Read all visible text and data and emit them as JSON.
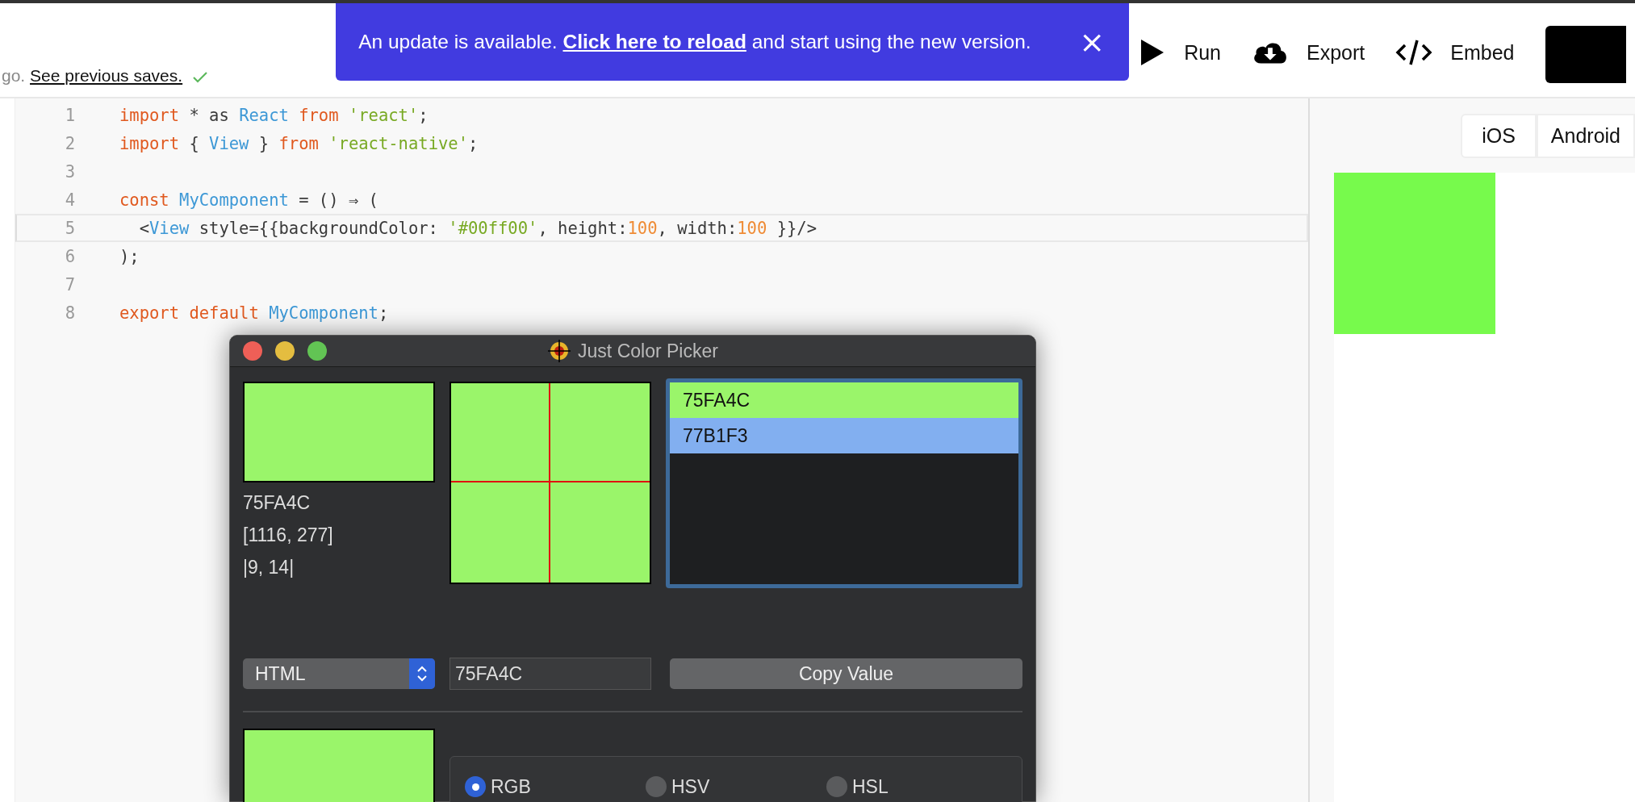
{
  "header": {
    "save_status": {
      "prefix": "go.",
      "link": "See previous saves."
    },
    "banner": {
      "before": "An update is available.",
      "link": "Click here to reload",
      "after": "and start using the new version.",
      "close": "×"
    },
    "actions": [
      {
        "label": "Run"
      },
      {
        "label": "Export"
      },
      {
        "label": "Embed"
      }
    ]
  },
  "editor": {
    "lines": [
      {
        "number": "1",
        "current": false,
        "tokens": [
          {
            "text": "import",
            "kind": "keyword"
          },
          {
            "text": " * as ",
            "kind": "plain"
          },
          {
            "text": "React",
            "kind": "ident"
          },
          {
            "text": " from ",
            "kind": "keyword"
          },
          {
            "text": "'react'",
            "kind": "string"
          },
          {
            "text": ";",
            "kind": "plain"
          }
        ]
      },
      {
        "number": "2",
        "current": false,
        "tokens": [
          {
            "text": "import",
            "kind": "keyword"
          },
          {
            "text": " { ",
            "kind": "plain"
          },
          {
            "text": "View",
            "kind": "ident"
          },
          {
            "text": " } ",
            "kind": "plain"
          },
          {
            "text": "from ",
            "kind": "keyword"
          },
          {
            "text": "'react-native'",
            "kind": "string"
          },
          {
            "text": ";",
            "kind": "plain"
          }
        ]
      },
      {
        "number": "3",
        "current": false
      },
      {
        "number": "4",
        "current": false,
        "tokens": [
          {
            "text": "const ",
            "kind": "keyword"
          },
          {
            "text": "MyComponent",
            "kind": "ident"
          },
          {
            "text": " = () ⇒ (",
            "kind": "plain"
          }
        ]
      },
      {
        "number": "5",
        "current": true,
        "tokens": [
          {
            "text": "  <",
            "kind": "plain"
          },
          {
            "text": "View",
            "kind": "ident"
          },
          {
            "text": " style={{backgroundColor: ",
            "kind": "plain"
          },
          {
            "text": "'#00ff00'",
            "kind": "string"
          },
          {
            "text": ", height:",
            "kind": "plain"
          },
          {
            "text": "100",
            "kind": "number"
          },
          {
            "text": ", width:",
            "kind": "plain"
          },
          {
            "text": "100",
            "kind": "number"
          },
          {
            "text": " }}/>",
            "kind": "plain"
          }
        ]
      },
      {
        "number": "6",
        "current": false,
        "tokens": [
          {
            "text": ");",
            "kind": "plain"
          }
        ]
      },
      {
        "number": "7",
        "current": false
      },
      {
        "number": "8",
        "current": false,
        "tokens": [
          {
            "text": "export default ",
            "kind": "keyword"
          },
          {
            "text": "MyComponent",
            "kind": "ident"
          },
          {
            "text": ";",
            "kind": "plain"
          }
        ]
      }
    ]
  },
  "preview": {
    "platforms": [
      {
        "label": "iOS",
        "selected": false
      },
      {
        "label": "Android",
        "selected": false
      }
    ]
  },
  "picker": {
    "title": "Just Color Picker",
    "readout": [
      "75FA4C",
      "[1116, 277]",
      "|9, 14|"
    ],
    "history": [
      {
        "value": "75FA4C",
        "color": "#9af56a"
      },
      {
        "value": "77B1F3",
        "color": "#82aff0"
      }
    ],
    "format": "HTML",
    "value": "75FA4C",
    "copy_button": "Copy Value",
    "modes": [
      {
        "label": "RGB",
        "selected": true
      },
      {
        "label": "HSV",
        "selected": false
      },
      {
        "label": "HSL",
        "selected": false
      }
    ]
  }
}
